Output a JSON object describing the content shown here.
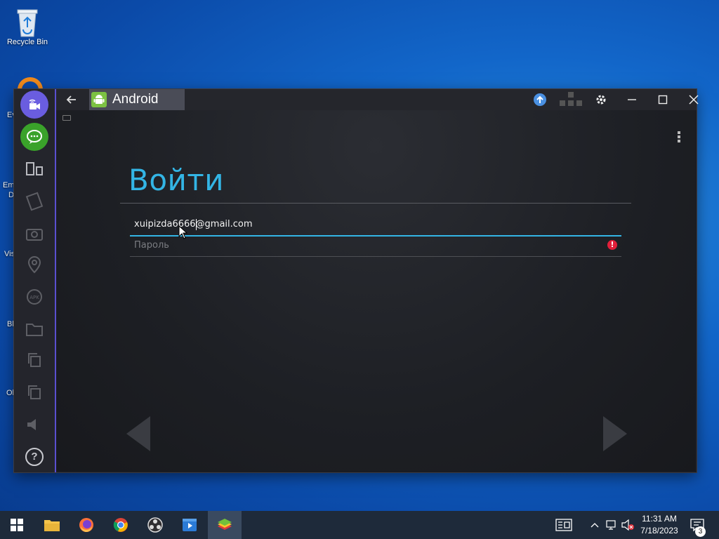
{
  "desktop": {
    "recycle_bin_label": "Recycle Bin",
    "partial_labels": [
      "Ev",
      "Em",
      "D",
      "Vis",
      "Bl",
      "Ol"
    ]
  },
  "window": {
    "tab_title": "Android",
    "sidebar": {
      "help_label": "?"
    }
  },
  "android": {
    "heading": "Войти",
    "email_value": "xuipizda6666@gmail.com",
    "password_placeholder": "Пароль",
    "error_mark": "!"
  },
  "taskbar": {
    "time": "11:31 AM",
    "date": "7/18/2023",
    "notification_count": "3"
  },
  "colors": {
    "accent": "#33b5e5",
    "error": "#e21f3a",
    "sidebar_accent": "#5a4fd0"
  }
}
